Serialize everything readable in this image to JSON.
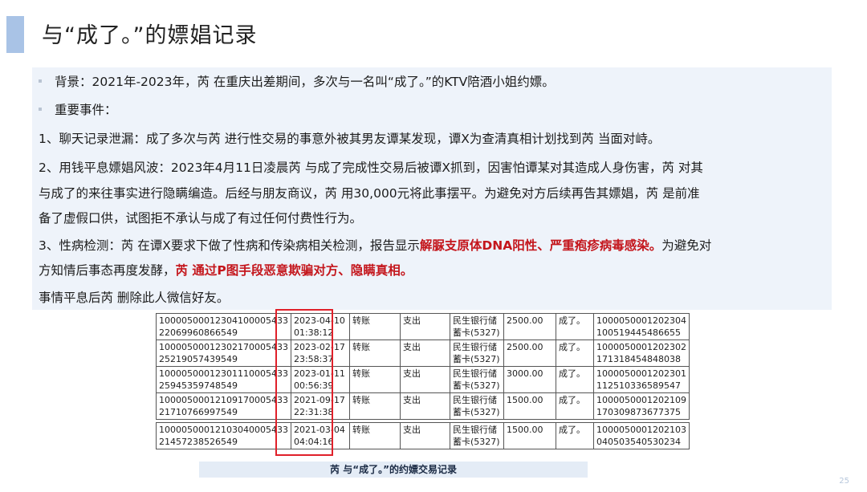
{
  "title": "与“成了。”的嫖娼记录",
  "content": {
    "background_line": "背景：2021年-2023年，芮  在重庆出差期间，多次与一名叫“成了。”的KTV陪酒小姐约嫖。",
    "events_heading": "重要事件：",
    "event1": "1、聊天记录泄漏：成了多次与芮  进行性交易的事意外被其男友谭某发现，谭X为查清真相计划找到芮  当面对峙。",
    "event2_line1": "2、用钱平息嫖娼风波：2023年4月11日凌晨芮  与成了完成性交易后被谭X抓到，因害怕谭某对其造成人身伤害，芮  对其",
    "event2_line2": "与成了的来往事实进行隐瞒编造。后经与朋友商议，芮  用30,000元将此事摆平。为避免对方后续再告其嫖娼，芮    是前准",
    "event2_line3": "备了虚假口供，试图拒不承认与成了有过任何付费性行为。",
    "event3_line1_prefix": "3、性病检测：芮  在谭X要求下做了性病和传染病相关检测，报告显示",
    "event3_line1_red": "解脲支原体DNA阳性、严重疱疹病毒感染。",
    "event3_line1_suffix": "为避免对",
    "event3_line2_prefix": "方知情后事态再度发酵，",
    "event3_line2_red": "芮    通过P图手段恶意欺骗对方、隐瞒真相。",
    "closing": "事情平息后芮    删除此人微信好友。"
  },
  "transactions": [
    {
      "serial_a": "10000500012304100005433",
      "serial_b": "22069960866549",
      "time_a": "2023-04-10",
      "time_b": "01:38:12",
      "type": "转账",
      "direction": "支出",
      "bank_a": "民生银行储",
      "bank_b": "蓄卡(5327)",
      "amount": "2500.00",
      "party": "成了。",
      "ref_a": "1000050001202304",
      "ref_b": "100519445486655"
    },
    {
      "serial_a": "10000500012302170005433",
      "serial_b": "25219057439549",
      "time_a": "2023-02-17",
      "time_b": "23:58:37",
      "type": "转账",
      "direction": "支出",
      "bank_a": "民生银行储",
      "bank_b": "蓄卡(5327)",
      "amount": "2500.00",
      "party": "成了。",
      "ref_a": "1000050001202302",
      "ref_b": "171318454848038"
    },
    {
      "serial_a": "10000500012301110005433",
      "serial_b": "25945359748549",
      "time_a": "2023-01-11",
      "time_b": "00:56:39",
      "type": "转账",
      "direction": "支出",
      "bank_a": "民生银行储",
      "bank_b": "蓄卡(5327)",
      "amount": "3000.00",
      "party": "成了。",
      "ref_a": "1000050001202301",
      "ref_b": "112510336589547"
    },
    {
      "serial_a": "10000500012109170005433",
      "serial_b": "21710766997549",
      "time_a": "2021-09-17",
      "time_b": "22:31:38",
      "type": "转账",
      "direction": "支出",
      "bank_a": "民生银行储",
      "bank_b": "蓄卡(5327)",
      "amount": "1500.00",
      "party": "成了。",
      "ref_a": "1000050001202109",
      "ref_b": "170309873677375"
    },
    {
      "serial_a": "10000500012103040005433",
      "serial_b": "21457238526549",
      "time_a": "2021-03-04",
      "time_b": "04:04:16",
      "type": "转账",
      "direction": "支出",
      "bank_a": "民生银行储",
      "bank_b": "蓄卡(5327)",
      "amount": "1500.00",
      "party": "成了。",
      "ref_a": "1000050001202103",
      "ref_b": "040503540530234"
    }
  ],
  "caption": "芮  与“成了。”的约嫖交易记录",
  "page_number": "25"
}
